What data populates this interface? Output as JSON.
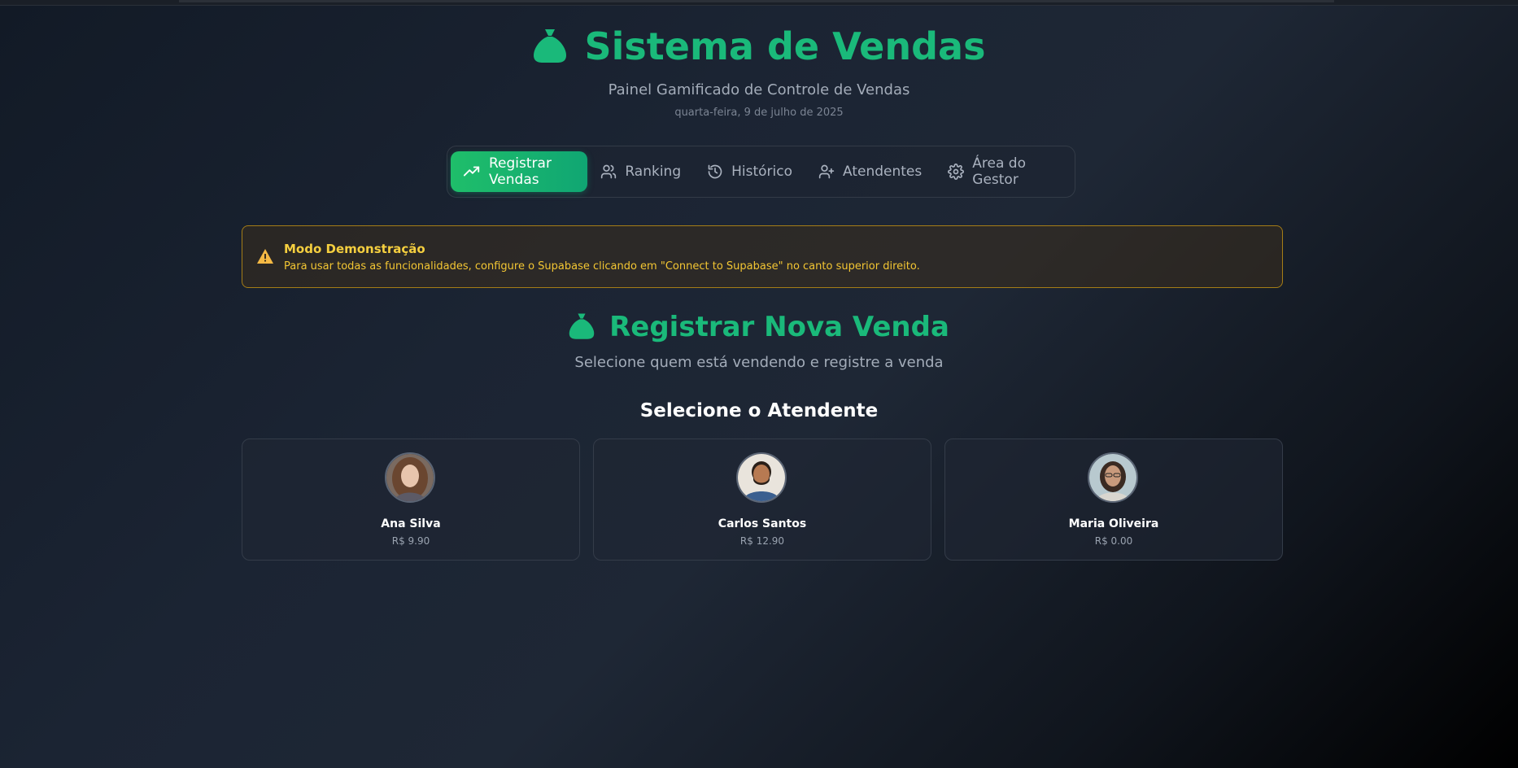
{
  "header": {
    "title": "Sistema de Vendas",
    "subtitle": "Painel Gamificado de Controle de Vendas",
    "date": "quarta-feira, 9 de julho de 2025",
    "icon": "money-bag-icon"
  },
  "nav": {
    "tabs": [
      {
        "label": "Registrar Vendas",
        "icon": "trending-up-icon",
        "active": true
      },
      {
        "label": "Ranking",
        "icon": "users-icon",
        "active": false
      },
      {
        "label": "Histórico",
        "icon": "history-icon",
        "active": false
      },
      {
        "label": "Atendentes",
        "icon": "user-plus-icon",
        "active": false
      },
      {
        "label": "Área do Gestor",
        "icon": "gear-icon",
        "active": false
      }
    ]
  },
  "alert": {
    "title": "Modo Demonstração",
    "text": "Para usar todas as funcionalidades, configure o Supabase clicando em \"Connect to Supabase\" no canto superior direito.",
    "icon": "warning-icon"
  },
  "register": {
    "title": "Registrar Nova Venda",
    "subtitle": "Selecione quem está vendendo e registre a venda",
    "select_title": "Selecione o Atendente"
  },
  "attendants": [
    {
      "name": "Ana Silva",
      "amount": "R$ 9.90"
    },
    {
      "name": "Carlos Santos",
      "amount": "R$ 12.90"
    },
    {
      "name": "Maria Oliveira",
      "amount": "R$ 0.00"
    }
  ],
  "colors": {
    "accent": "#1ab97a",
    "active_tab": "#1fbe6a",
    "warning_border": "#a57d16",
    "warning_text": "#f3c633"
  }
}
